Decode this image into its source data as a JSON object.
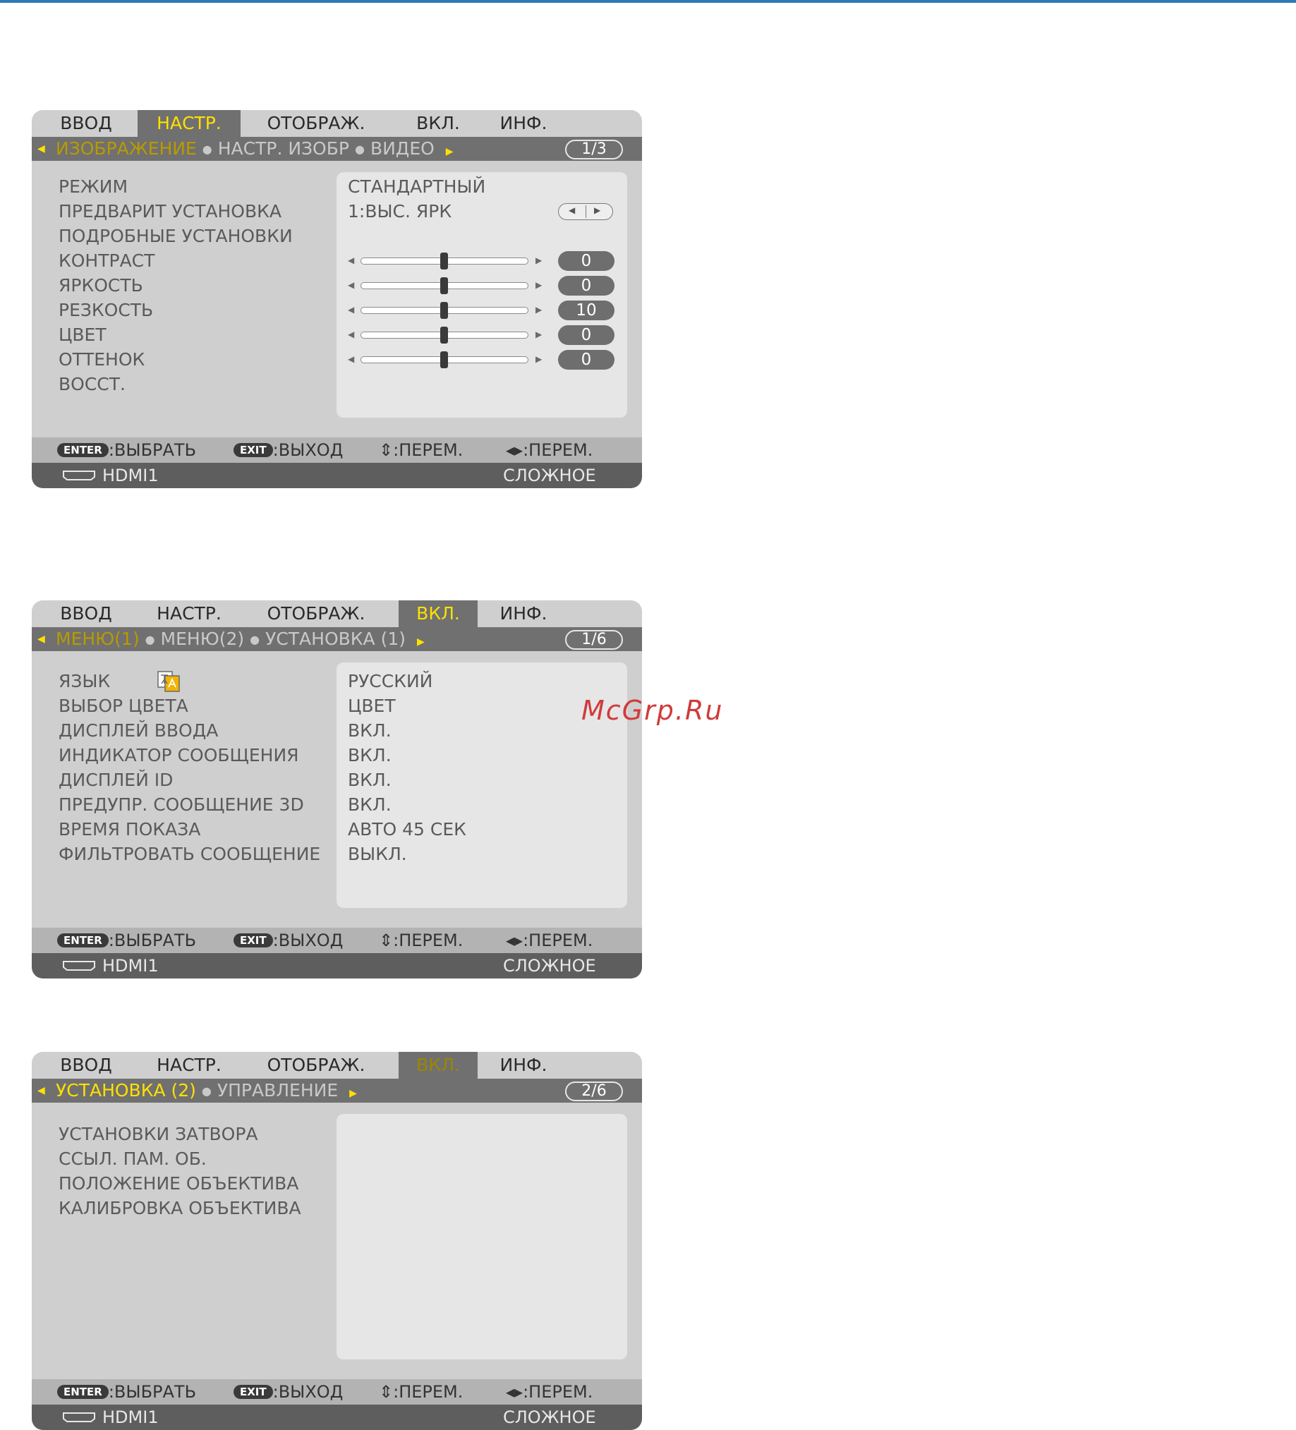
{
  "watermark": "McGrp.Ru",
  "common": {
    "tabs": [
      "ВВОД",
      "НАСТР.",
      "ОТОБРАЖ.",
      "ВКЛ.",
      "ИНФ."
    ],
    "help": {
      "enter_key": "ENTER",
      "enter_text": ":ВЫБРАТЬ",
      "exit_key": "EXIT",
      "exit_text": ":ВЫХОД",
      "updown": "⇕:ПЕРЕМ.",
      "leftright": "◂▸:ПЕРЕМ."
    },
    "status": {
      "source": "HDMI1",
      "mode": "СЛОЖНОЕ"
    }
  },
  "menu1": {
    "active_tab": "НАСТР.",
    "subtabs": {
      "current": "ИЗОБРАЖЕНИЕ",
      "others": [
        "НАСТР. ИЗОБР",
        "ВИДЕО"
      ],
      "page": "1/3"
    },
    "rows": [
      {
        "label": "РЕЖИМ",
        "value": "СТАНДАРТНЫЙ"
      },
      {
        "label": "ПРЕДВАРИТ УСТАНОВКА",
        "value": "1:ВЫС. ЯРК"
      },
      {
        "label": "ПОДРОБНЫЕ УСТАНОВКИ"
      },
      {
        "label": "КОНТРАСТ",
        "value": "0",
        "slider": 0.5
      },
      {
        "label": "ЯРКОСТЬ",
        "value": "0",
        "slider": 0.5
      },
      {
        "label": "РЕЗКОСТЬ",
        "value": "10",
        "slider": 0.5
      },
      {
        "label": "ЦВЕТ",
        "value": "0",
        "slider": 0.5
      },
      {
        "label": "ОТТЕНОК",
        "value": "0",
        "slider": 0.5
      },
      {
        "label": "ВОССТ."
      }
    ]
  },
  "menu2": {
    "active_tab": "ВКЛ.",
    "subtabs": {
      "current": "МЕНЮ(1)",
      "others": [
        "МЕНЮ(2)",
        "УСТАНОВКА (1)"
      ],
      "page": "1/6"
    },
    "rows": [
      {
        "label": "ЯЗЫК",
        "value": "РУССКИЙ"
      },
      {
        "label": "ВЫБОР ЦВЕТА",
        "value": "ЦВЕТ"
      },
      {
        "label": "ДИСПЛЕЙ ВВОДА",
        "value": "ВКЛ."
      },
      {
        "label": "ИНДИКАТОР СООБЩЕНИЯ",
        "value": "ВКЛ."
      },
      {
        "label": "ДИСПЛЕЙ ID",
        "value": "ВКЛ."
      },
      {
        "label": "ПРЕДУПР. СООБЩЕНИЕ 3D",
        "value": "ВКЛ."
      },
      {
        "label": "ВРЕМЯ ПОКАЗА",
        "value": "АВТО 45 СЕК"
      },
      {
        "label": "ФИЛЬТРОВАТЬ СООБЩЕНИЕ",
        "value": "ВЫКЛ."
      }
    ]
  },
  "menu3": {
    "active_tab": "ВКЛ.",
    "subtabs": {
      "current": "УСТАНОВКА (2)",
      "others": [
        "УПРАВЛЕНИЕ"
      ],
      "page": "2/6"
    },
    "rows": [
      {
        "label": "УСТАНОВКИ ЗАТВОРА"
      },
      {
        "label": "ССЫЛ. ПАМ. ОБ."
      },
      {
        "label": "ПОЛОЖЕНИЕ ОБЪЕКТИВА"
      },
      {
        "label": "КАЛИБРОВКА ОБЪЕКТИВА"
      }
    ]
  },
  "colors": {
    "highlight": "#ffe000",
    "bar": "#707070",
    "panel": "#cfcfcf"
  }
}
